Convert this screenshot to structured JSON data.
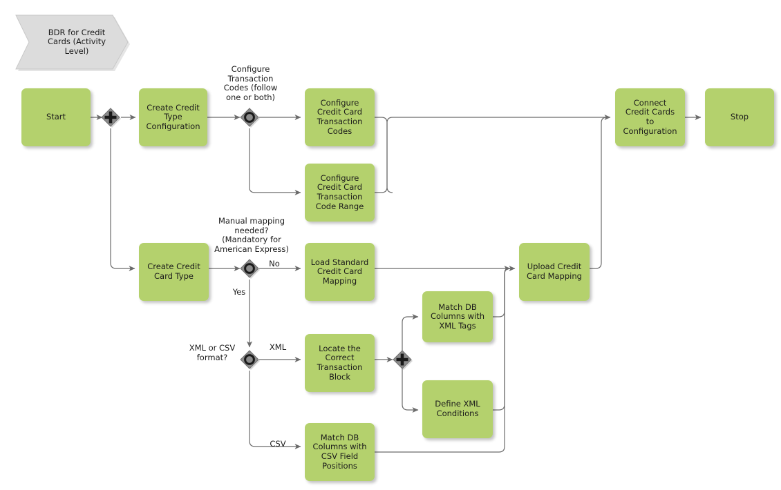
{
  "diagram": {
    "title_banner": "BDR for Credit\nCards (Activity\nLevel)",
    "colors": {
      "task_fill": "#b4d16d",
      "banner_fill": "#dcdcdc",
      "gateway_fill": "#8c8c8c",
      "gateway_stroke": "#4d4d4d",
      "edge_stroke": "#6b6b6b",
      "text": "#1a1a1a"
    },
    "tasks": [
      {
        "id": "start",
        "label": "Start"
      },
      {
        "id": "create-credit-type-configuration",
        "label": "Create Credit\nType\nConfiguration"
      },
      {
        "id": "configure-cc-transaction-codes",
        "label": "Configure\nCredit Card\nTransaction\nCodes"
      },
      {
        "id": "configure-cc-transaction-code-range",
        "label": "Configure\nCredit Card\nTransaction\nCode Range"
      },
      {
        "id": "connect-credit-cards-to-configuration",
        "label": "Connect\nCredit Cards\nto\nConfiguration"
      },
      {
        "id": "stop",
        "label": "Stop"
      },
      {
        "id": "create-credit-card-type",
        "label": "Create Credit\nCard Type"
      },
      {
        "id": "load-standard-credit-card-mapping",
        "label": "Load Standard\nCredit Card\nMapping"
      },
      {
        "id": "upload-credit-card-mapping",
        "label": "Upload Credit\nCard Mapping"
      },
      {
        "id": "locate-the-correct-transaction-block",
        "label": "Locate the\nCorrect\nTransaction\nBlock"
      },
      {
        "id": "match-db-columns-with-xml-tags",
        "label": "Match DB\nColumns with\nXML Tags"
      },
      {
        "id": "define-xml-conditions",
        "label": "Define XML\nConditions"
      },
      {
        "id": "match-db-columns-with-csv-field-positions",
        "label": "Match DB\nColumns with\nCSV Field\nPositions"
      }
    ],
    "gateways": [
      {
        "id": "parallel-split-start",
        "type": "parallel"
      },
      {
        "id": "inclusive-transaction-codes",
        "type": "inclusive"
      },
      {
        "id": "inclusive-manual-mapping",
        "type": "inclusive"
      },
      {
        "id": "inclusive-xml-or-csv",
        "type": "inclusive"
      },
      {
        "id": "parallel-split-xml",
        "type": "parallel"
      }
    ],
    "annotations": {
      "transaction_codes_question": "Configure\nTransaction\nCodes (follow\none or both)",
      "manual_mapping_question": "Manual mapping\nneeded?\n(Mandatory for\nAmerican Express)",
      "xml_or_csv_question": "XML or CSV\nformat?"
    },
    "flow_labels": {
      "no": "No",
      "yes": "Yes",
      "xml": "XML",
      "csv": "CSV"
    }
  }
}
